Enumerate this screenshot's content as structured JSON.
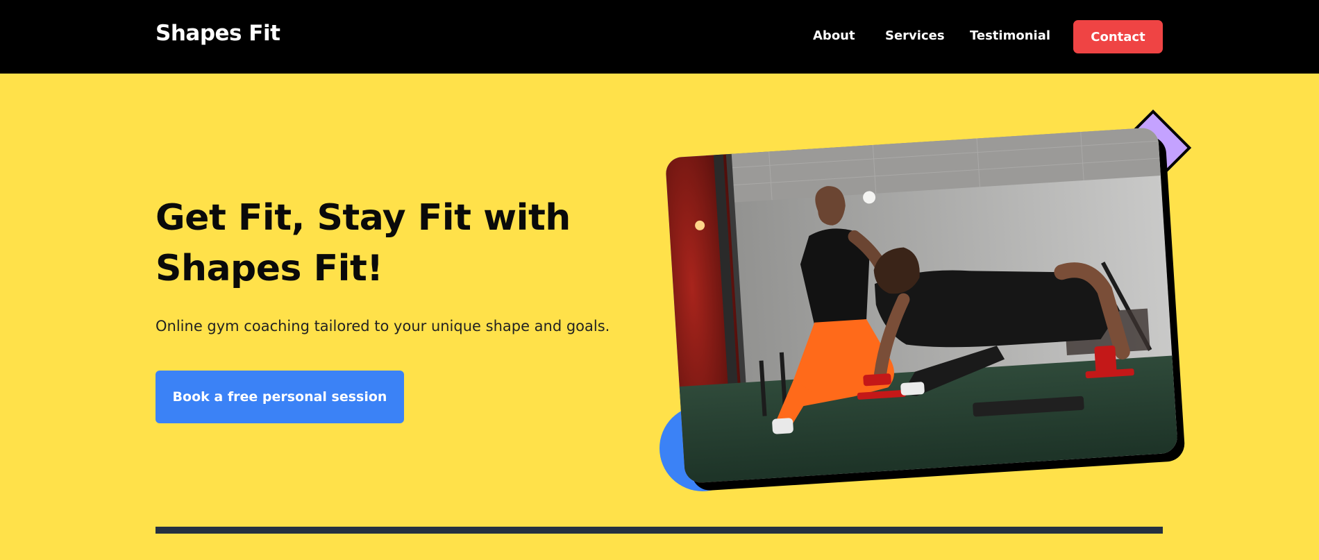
{
  "brand": "Shapes Fit",
  "nav": {
    "links": [
      "About",
      "Services",
      "Testimonial"
    ],
    "contact_label": "Contact"
  },
  "hero": {
    "title": "Get Fit, Stay Fit with Shapes Fit!",
    "subtitle": "Online gym coaching tailored to your unique shape and goals.",
    "cta_label": "Book a free personal session"
  },
  "colors": {
    "background": "#FFE14A",
    "navbar": "#000000",
    "contact_button": "#EF4444",
    "cta_button": "#3B82F6",
    "diamond": "#C4A2FF",
    "circle": "#3B82F6",
    "divider": "#253040"
  }
}
